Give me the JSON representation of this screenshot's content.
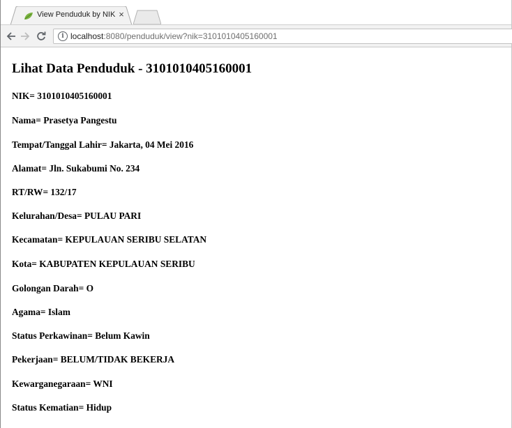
{
  "browser": {
    "tab_title": "View Penduduk by NIK",
    "tab_close": "×",
    "url_host": "localhost",
    "url_rest": ":8080/penduduk/view?nik=3101010405160001"
  },
  "page": {
    "heading": "Lihat Data Penduduk - 3101010405160001",
    "fields": [
      "NIK= 3101010405160001",
      "Nama= Prasetya Pangestu",
      "Tempat/Tanggal Lahir= Jakarta, 04 Mei 2016",
      "Alamat= Jln. Sukabumi No. 234",
      "RT/RW= 132/17",
      "Kelurahan/Desa= PULAU PARI",
      "Kecamatan= KEPULAUAN SERIBU SELATAN",
      "Kota= KABUPATEN KEPULAUAN SERIBU",
      "Golongan Darah= O",
      "Agama= Islam",
      "Status Perkawinan= Belum Kawin",
      "Pekerjaan= BELUM/TIDAK BEKERJA",
      "Kewarganegaraan= WNI",
      "Status Kematian= Hidup"
    ]
  },
  "icons": {
    "favicon": "leaf-icon",
    "back": "back-arrow-icon",
    "forward": "forward-arrow-icon",
    "reload": "reload-icon",
    "info": "info-icon",
    "close": "close-icon"
  },
  "colors": {
    "favicon": "#7cb342",
    "toolbar": "#f2f2f2"
  }
}
